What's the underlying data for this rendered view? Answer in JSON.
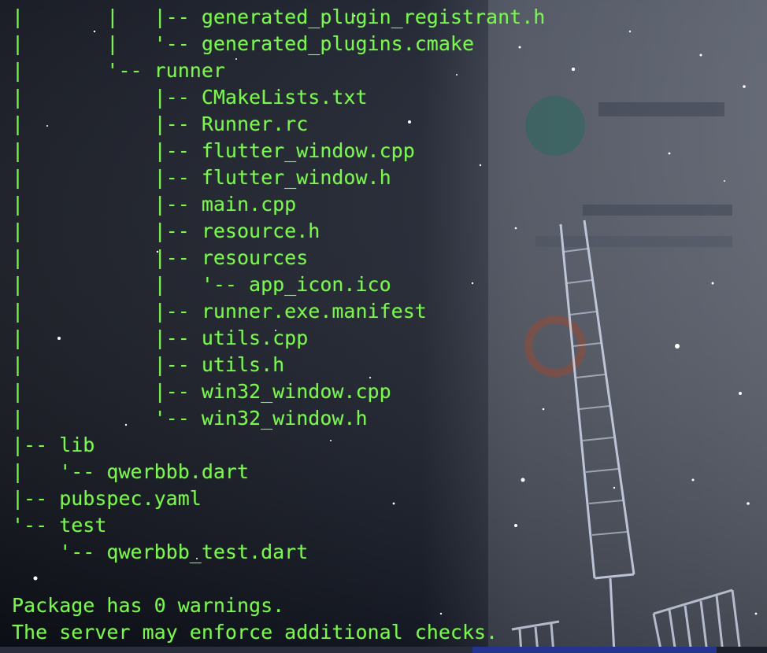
{
  "terminal": {
    "lines": [
      "|       |   |-- generated_plugin_registrant.h",
      "|       |   '-- generated_plugins.cmake",
      "|       '-- runner",
      "|           |-- CMakeLists.txt",
      "|           |-- Runner.rc",
      "|           |-- flutter_window.cpp",
      "|           |-- flutter_window.h",
      "|           |-- main.cpp",
      "|           |-- resource.h",
      "|           |-- resources",
      "|           |   '-- app_icon.ico",
      "|           |-- runner.exe.manifest",
      "|           |-- utils.cpp",
      "|           |-- utils.h",
      "|           |-- win32_window.cpp",
      "|           '-- win32_window.h",
      "|-- lib",
      "|   '-- qwerbbb.dart",
      "|-- pubspec.yaml",
      "'-- test",
      "    '-- qwerbbb_test.dart",
      "",
      "Package has 0 warnings.",
      "The server may enforce additional checks."
    ]
  },
  "colors": {
    "text": "#7cf552",
    "background": "#12151f"
  }
}
